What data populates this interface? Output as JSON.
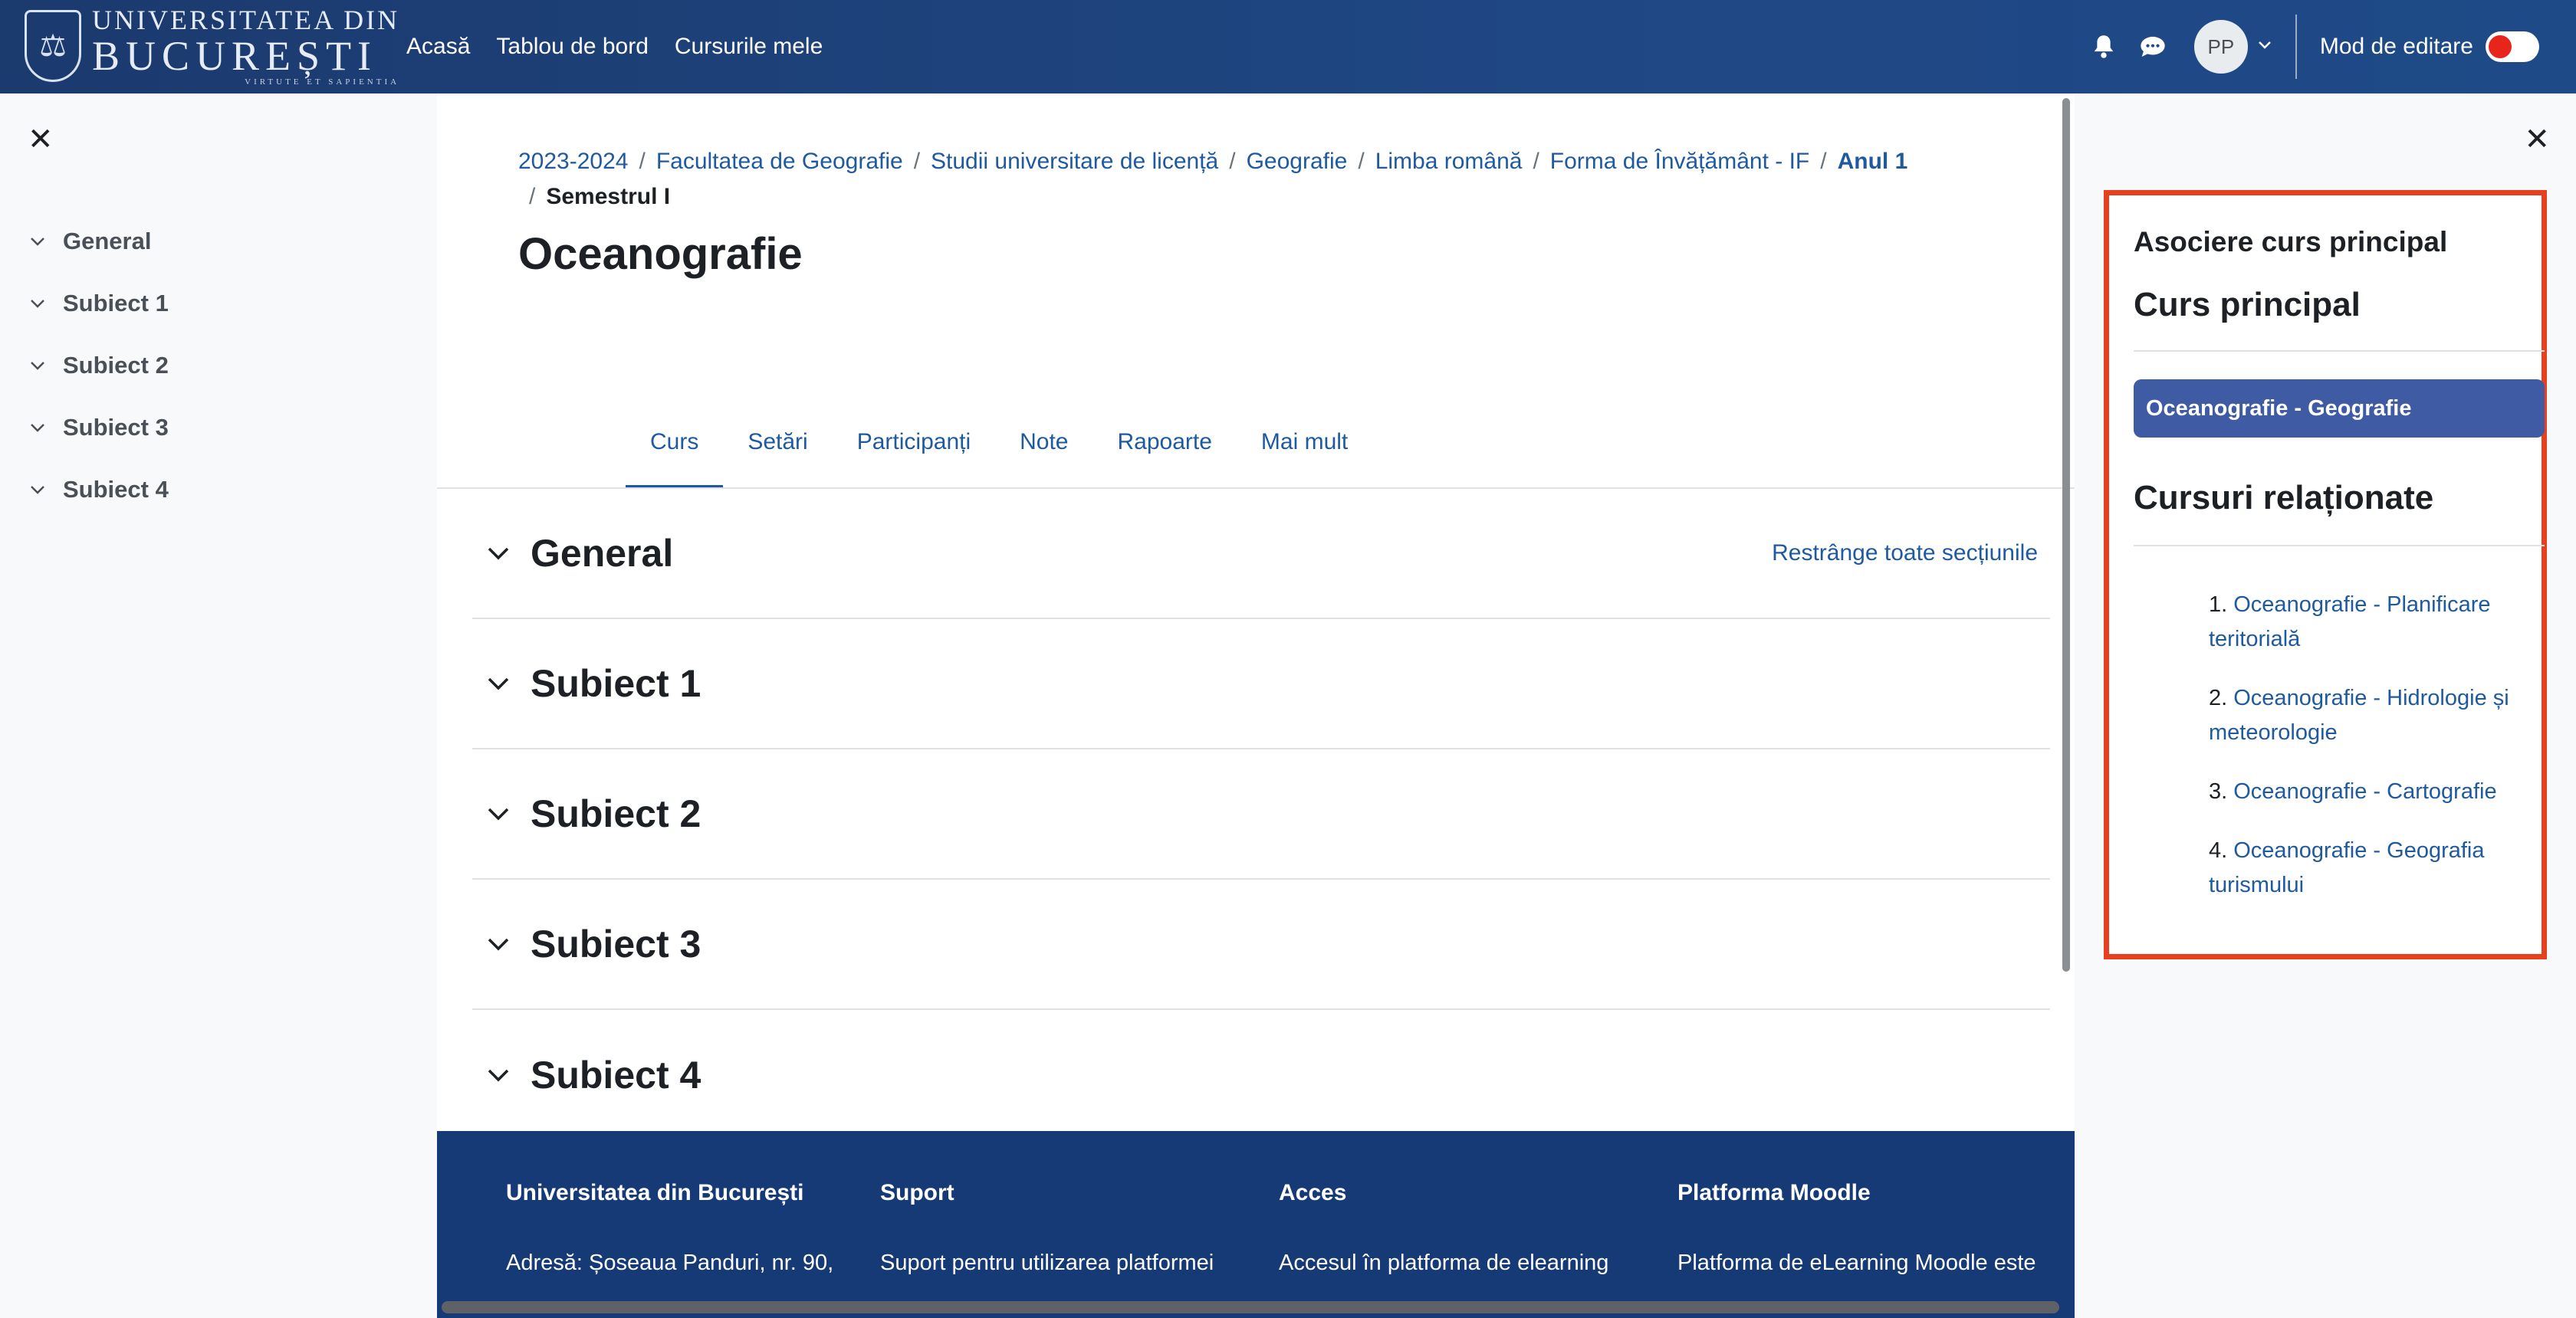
{
  "header": {
    "logo": {
      "line1": "UNIVERSITATEA DIN",
      "line2": "BUCUREȘTI",
      "line3": "VIRTUTE ET SAPIENTIA"
    },
    "nav": [
      {
        "label": "Acasă"
      },
      {
        "label": "Tablou de bord"
      },
      {
        "label": "Cursurile mele"
      }
    ],
    "avatar_initials": "PP",
    "edit_mode_label": "Mod de editare",
    "edit_mode_on": false
  },
  "left_drawer": {
    "items": [
      {
        "label": "General"
      },
      {
        "label": "Subiect 1"
      },
      {
        "label": "Subiect 2"
      },
      {
        "label": "Subiect 3"
      },
      {
        "label": "Subiect 4"
      }
    ]
  },
  "breadcrumb": {
    "items": [
      {
        "label": "2023-2024"
      },
      {
        "label": "Facultatea de Geografie"
      },
      {
        "label": "Studii universitare de licență"
      },
      {
        "label": "Geografie"
      },
      {
        "label": "Limba română"
      },
      {
        "label": "Forma de Învățământ - IF"
      },
      {
        "label": "Anul 1"
      }
    ],
    "current": "Semestrul I"
  },
  "page": {
    "title": "Oceanografie",
    "tabs": [
      {
        "label": "Curs"
      },
      {
        "label": "Setări"
      },
      {
        "label": "Participanți"
      },
      {
        "label": "Note"
      },
      {
        "label": "Rapoarte"
      },
      {
        "label": "Mai mult"
      }
    ],
    "collapse_all_label": "Restrânge toate secțiunile",
    "sections": [
      {
        "title": "General"
      },
      {
        "title": "Subiect 1"
      },
      {
        "title": "Subiect 2"
      },
      {
        "title": "Subiect 3"
      },
      {
        "title": "Subiect 4"
      }
    ]
  },
  "footer": {
    "columns": [
      {
        "heading": "Universitatea din București",
        "text": "Adresă: Șoseaua Panduri, nr. 90,"
      },
      {
        "heading": "Suport",
        "text": "Suport pentru utilizarea platformei"
      },
      {
        "heading": "Acces",
        "text": "Accesul în platforma de elearning"
      },
      {
        "heading": "Platforma Moodle",
        "text": "Platforma de eLearning Moodle este"
      }
    ]
  },
  "right_drawer": {
    "block_title": "Asociere curs principal",
    "main_course_heading": "Curs principal",
    "main_course": "Oceanografie - Geografie",
    "related_heading": "Cursuri relaționate",
    "related": [
      {
        "num": "1.",
        "label": "Oceanografie - Planificare teritorială"
      },
      {
        "num": "2.",
        "label": "Oceanografie - Hidrologie și meteorologie"
      },
      {
        "num": "3.",
        "label": "Oceanografie - Cartografie"
      },
      {
        "num": "4.",
        "label": "Oceanografie - Geografia turismului"
      }
    ]
  }
}
